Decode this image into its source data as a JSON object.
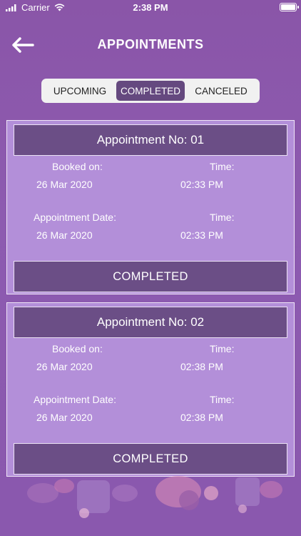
{
  "status_bar": {
    "carrier": "Carrier",
    "time": "2:38 PM"
  },
  "nav": {
    "title": "APPOINTMENTS"
  },
  "tabs": [
    {
      "label": "UPCOMING",
      "active": false
    },
    {
      "label": "COMPLETED",
      "active": true
    },
    {
      "label": "CANCELED",
      "active": false
    }
  ],
  "appointments": [
    {
      "title": "Appointment No: 01",
      "booked_label": "Booked on:",
      "booked_date": "26 Mar 2020",
      "booked_time_label": "Time:",
      "booked_time": "02:33 PM",
      "appt_label": "Appointment Date:",
      "appt_date": "26 Mar 2020",
      "appt_time_label": "Time:",
      "appt_time": "02:33 PM",
      "status": "COMPLETED"
    },
    {
      "title": "Appointment No: 02",
      "booked_label": "Booked on:",
      "booked_date": "26 Mar 2020",
      "booked_time_label": "Time:",
      "booked_time": "02:38 PM",
      "appt_label": "Appointment Date:",
      "appt_date": "26 Mar 2020",
      "appt_time_label": "Time:",
      "appt_time": "02:38 PM",
      "status": "COMPLETED"
    }
  ],
  "colors": {
    "background": "#8a55a8",
    "card": "#b38fd9",
    "card_header": "#6b4e86",
    "active_tab": "#65497f"
  }
}
